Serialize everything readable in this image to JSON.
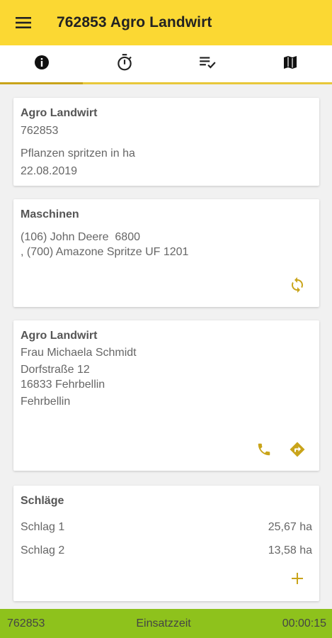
{
  "appbar": {
    "title": "762853 Agro Landwirt",
    "menu_icon": "menu-icon"
  },
  "tabs": [
    {
      "icon": "info-icon",
      "active": true
    },
    {
      "icon": "timer-icon",
      "active": false
    },
    {
      "icon": "checklist-icon",
      "active": false
    },
    {
      "icon": "map-icon",
      "active": false
    }
  ],
  "order": {
    "customer": "Agro Landwirt",
    "number": "762853",
    "task": "Pflanzen spritzen in ha",
    "date": "22.08.2019"
  },
  "machines": {
    "title": "Maschinen",
    "line1": "(106) John Deere  6800",
    "line2": ", (700) Amazone Spritze UF 1201",
    "action_icon": "sync-icon"
  },
  "contact": {
    "company": "Agro Landwirt",
    "person": "Frau Michaela Schmidt",
    "street": "Dorfstraße 12",
    "city": "16833 Fehrbellin",
    "place": "Fehrbellin",
    "phone_icon": "phone-icon",
    "directions_icon": "directions-icon"
  },
  "fields": {
    "title": "Schläge",
    "rows": [
      {
        "name": "Schlag 1",
        "area": "25,67 ha"
      },
      {
        "name": "Schlag 2",
        "area": "13,58 ha"
      }
    ],
    "add_icon": "plus-icon"
  },
  "footer": {
    "order_number": "762853",
    "label": "Einsatzzeit",
    "time": "00:00:15"
  },
  "colors": {
    "appbar": "#fbd833",
    "accent": "#c9a41a",
    "footer": "#8ec21c"
  }
}
